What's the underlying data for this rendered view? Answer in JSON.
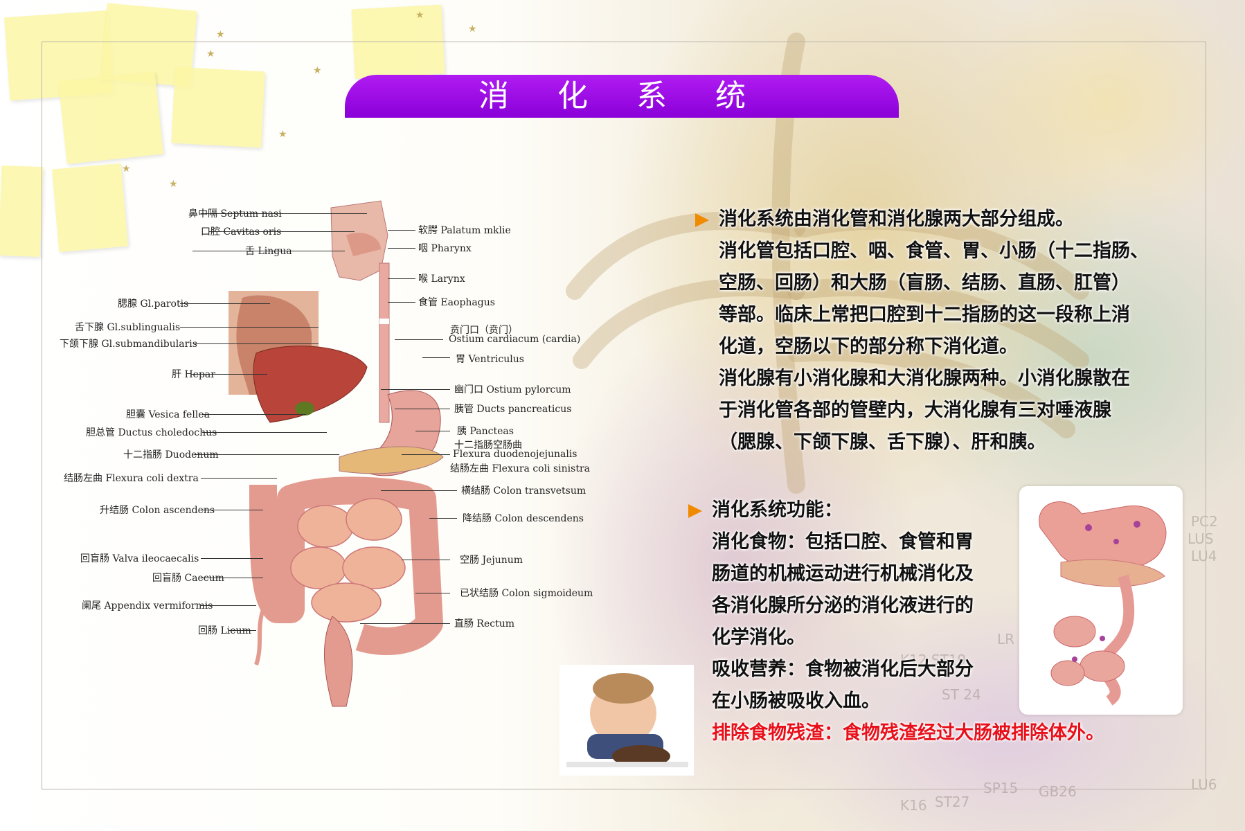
{
  "title": "消 化 系 统",
  "anatomy_labels": [
    "鼻中隔 Septum nasi",
    "口腔 Cavitas oris",
    "舌 Lingua",
    "腮腺 Gl.parotis",
    "舌下腺 Gl.sublingualis",
    "下颌下腺 Gl.submandibularis",
    "肝 Hepar",
    "胆囊 Vesica fellea",
    "胆总管 Ductus choledochus",
    "十二指肠 Duodenum",
    "结肠左曲 Flexura coli dextra",
    "升结肠 Colon ascendens",
    "回盲肠 Valva ileocaecalis",
    "回盲肠 Caecum",
    "阑尾 Appendix vermiformis",
    "回肠 Lieum",
    "软腭 Palatum mklie",
    "咽 Pharynx",
    "喉 Larynx",
    "食管 Eaophagus",
    "贲门口（贲门）",
    "Ostium cardiacum (cardia)",
    "胃 Ventriculus",
    "幽门口 Ostium pylorcum",
    "胰管 Ducts pancreaticus",
    "胰 Pancteas",
    "十二指肠空肠曲",
    "Flexura duodenojejunalis",
    "结肠左曲 Flexura coli sinistra",
    "横结肠 Colon transvetsum",
    "降结肠 Colon descendens",
    "空肠 Jejunum",
    "已状结肠 Colon sigmoideum",
    "直肠 Rectum"
  ],
  "section1": {
    "lines": [
      "消化系统由消化管和消化腺两大部分组成。",
      "消化管包括口腔、咽、食管、胃、小肠（十二指肠、",
      "空肠、回肠）和大肠（盲肠、结肠、直肠、肛管）",
      "等部。临床上常把口腔到十二指肠的这一段称上消",
      "化道，空肠以下的部分称下消化道。",
      "消化腺有小消化腺和大消化腺两种。小消化腺散在",
      "于消化管各部的管壁内，大消化腺有三对唾液腺",
      "（腮腺、下颌下腺、舌下腺）、肝和胰。"
    ]
  },
  "section2": {
    "lines": [
      "消化系统功能：",
      "消化食物：包括口腔、食管和胃",
      "肠道的机械运动进行机械消化及",
      "各消化腺所分泌的消化液进行的",
      "化学消化。",
      "吸收营养：食物被消化后大部分",
      "在小肠被吸收入血。"
    ],
    "highlight_line": "排除食物残渣：食物残渣经过大肠被排除体外。"
  },
  "colors": {
    "title_bar": "#9b10e6",
    "arrow": "#f08a00",
    "highlight_text": "#e8101a",
    "body_text": "#111111"
  }
}
